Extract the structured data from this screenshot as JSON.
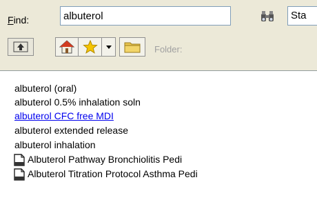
{
  "search": {
    "label_accel": "F",
    "label_rest": "ind:",
    "value": "albuterol",
    "start_value": "Sta"
  },
  "toolbar": {
    "folder_label": "Folder:"
  },
  "icons": {
    "up": "up-arrow-icon",
    "home": "home-icon",
    "favorites": "star-icon",
    "dropdown": "dropdown-arrow-icon",
    "folder": "folder-icon",
    "binoculars": "binoculars-icon",
    "document": "document-icon"
  },
  "colors": {
    "chrome": "#ece9d8",
    "link": "#0000ee",
    "star": "#f5c400",
    "folder": "#e8c550",
    "home_roof": "#d23b1f"
  },
  "results": [
    {
      "label": "albuterol (oral)",
      "type": "text"
    },
    {
      "label": "albuterol 0.5% inhalation soln",
      "type": "text"
    },
    {
      "label": "albuterol CFC free MDI",
      "type": "link"
    },
    {
      "label": "albuterol extended release",
      "type": "text"
    },
    {
      "label": "albuterol inhalation",
      "type": "text"
    },
    {
      "label": "Albuterol Pathway Bronchiolitis Pedi",
      "type": "document"
    },
    {
      "label": "Albuterol Titration Protocol Asthma Pedi",
      "type": "document"
    }
  ]
}
